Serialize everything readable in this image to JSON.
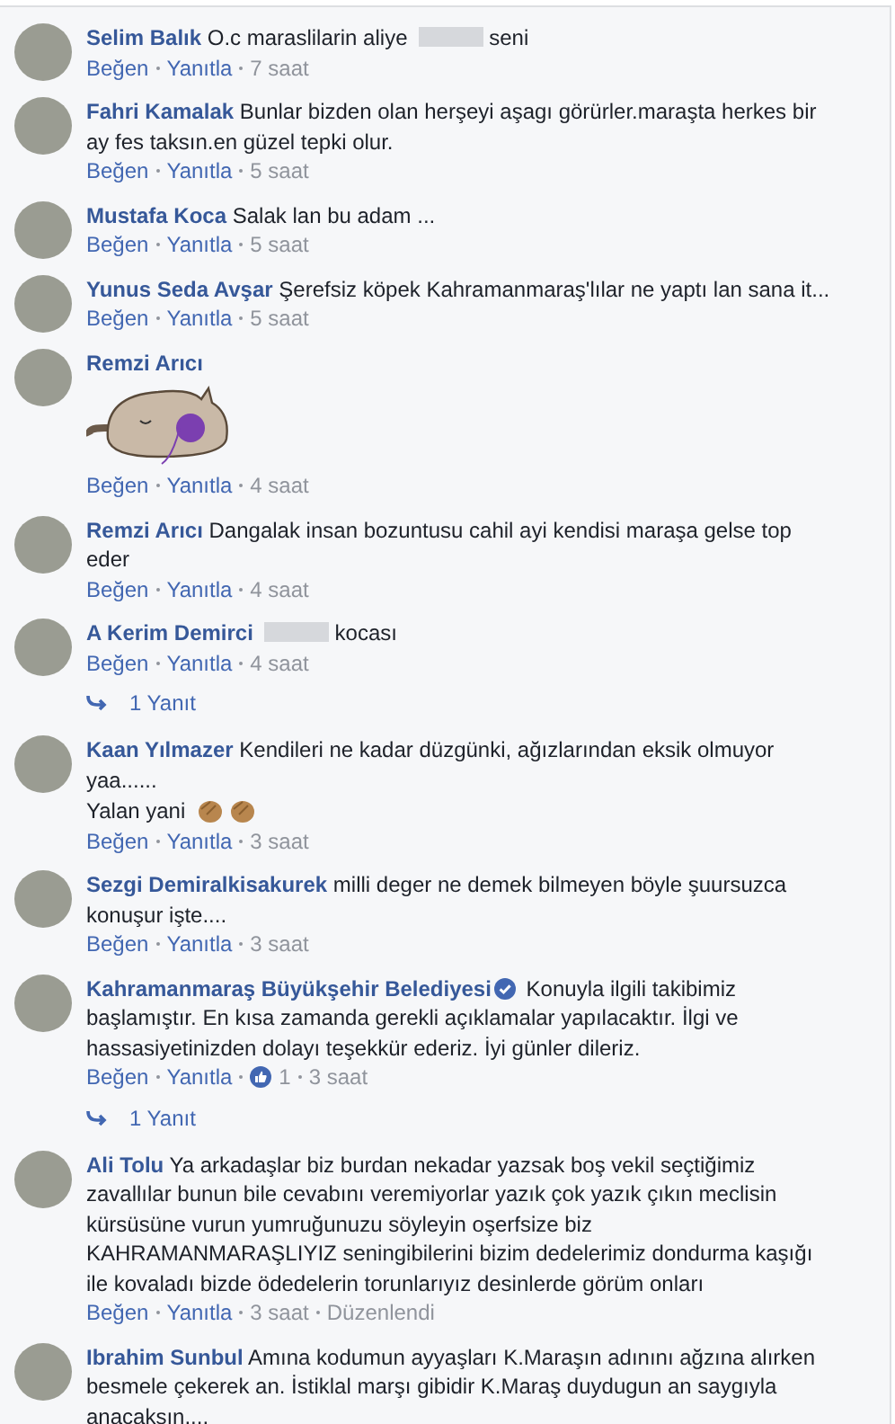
{
  "comments": [
    {
      "author": "Selim Balık",
      "parts": [
        {
          "kind": "text",
          "text": "O.c maraslilarin aliye"
        },
        {
          "kind": "blur"
        },
        {
          "kind": "text",
          "text": "seni"
        }
      ],
      "meta": [
        {
          "kind": "link",
          "text": "Beğen"
        },
        {
          "kind": "link",
          "text": "Yanıtla"
        },
        {
          "kind": "text",
          "text": "7 saat"
        }
      ]
    },
    {
      "author": "Fahri Kamalak",
      "parts": [
        {
          "kind": "text",
          "text": "Bunlar bizden olan herşeyi aşagı görürler.maraşta herkes bir ay fes taksın.en güzel tepki olur."
        }
      ],
      "meta": [
        {
          "kind": "link",
          "text": "Beğen"
        },
        {
          "kind": "link",
          "text": "Yanıtla"
        },
        {
          "kind": "text",
          "text": "5 saat"
        }
      ]
    },
    {
      "author": "Mustafa Koca",
      "parts": [
        {
          "kind": "text",
          "text": "Salak lan bu adam ..."
        }
      ],
      "meta": [
        {
          "kind": "link",
          "text": "Beğen"
        },
        {
          "kind": "link",
          "text": "Yanıtla"
        },
        {
          "kind": "text",
          "text": "5 saat"
        }
      ]
    },
    {
      "author": "Yunus Seda Avşar",
      "parts": [
        {
          "kind": "text",
          "text": "Şerefsiz köpek Kahramanmaraş'lılar ne yaptı lan sana it..."
        }
      ],
      "meta": [
        {
          "kind": "link",
          "text": "Beğen"
        },
        {
          "kind": "link",
          "text": "Yanıtla"
        },
        {
          "kind": "text",
          "text": "5 saat"
        }
      ]
    },
    {
      "author": "Remzi Arıcı",
      "parts": [
        {
          "kind": "sticker"
        }
      ],
      "meta": [
        {
          "kind": "link",
          "text": "Beğen"
        },
        {
          "kind": "link",
          "text": "Yanıtla"
        },
        {
          "kind": "text",
          "text": "4 saat"
        }
      ]
    },
    {
      "author": "Remzi Arıcı",
      "parts": [
        {
          "kind": "text",
          "text": "Dangalak insan bozuntusu cahil ayi kendisi maraşa gelse top eder"
        }
      ],
      "meta": [
        {
          "kind": "link",
          "text": "Beğen"
        },
        {
          "kind": "link",
          "text": "Yanıtla"
        },
        {
          "kind": "text",
          "text": "4 saat"
        }
      ]
    },
    {
      "author": "A Kerim Demirci",
      "parts": [
        {
          "kind": "blur"
        },
        {
          "kind": "text",
          "text": "kocası"
        }
      ],
      "meta": [
        {
          "kind": "link",
          "text": "Beğen"
        },
        {
          "kind": "link",
          "text": "Yanıtla"
        },
        {
          "kind": "text",
          "text": "4 saat"
        }
      ],
      "replies": "1 Yanıt"
    },
    {
      "author": "Kaan Yılmazer",
      "parts": [
        {
          "kind": "text",
          "text": "Kendileri ne kadar düzgünki, ağızlarından eksik olmuyor yaa......"
        },
        {
          "kind": "break"
        },
        {
          "kind": "text",
          "text": "Yalan yani"
        },
        {
          "kind": "emoji"
        },
        {
          "kind": "emoji"
        }
      ],
      "meta": [
        {
          "kind": "link",
          "text": "Beğen"
        },
        {
          "kind": "link",
          "text": "Yanıtla"
        },
        {
          "kind": "text",
          "text": "3 saat"
        }
      ]
    },
    {
      "author": "Sezgi Demiralkisakurek",
      "parts": [
        {
          "kind": "text",
          "text": "milli deger ne demek bilmeyen böyle şuursuzca konuşur işte...."
        }
      ],
      "meta": [
        {
          "kind": "link",
          "text": "Beğen"
        },
        {
          "kind": "link",
          "text": "Yanıtla"
        },
        {
          "kind": "text",
          "text": "3 saat"
        }
      ]
    },
    {
      "author": "Kahramanmaraş Büyükşehir Belediyesi",
      "verified": true,
      "parts": [
        {
          "kind": "text",
          "text": "Konuyla ilgili takibimiz başlamıştır. En kısa zamanda gerekli açıklamalar yapılacaktır. İlgi ve hassasiyetinizden dolayı teşekkür ederiz. İyi günler dileriz."
        }
      ],
      "meta": [
        {
          "kind": "link",
          "text": "Beğen"
        },
        {
          "kind": "link",
          "text": "Yanıtla"
        },
        {
          "kind": "likes",
          "text": "1"
        },
        {
          "kind": "text",
          "text": "3 saat"
        }
      ],
      "replies": "1 Yanıt"
    },
    {
      "author": "Ali Tolu",
      "parts": [
        {
          "kind": "text",
          "text": "Ya arkadaşlar biz burdan nekadar yazsak boş vekil seçtiğimiz zavallılar bunun bile cevabını veremiyorlar yazık çok yazık çıkın meclisin kürsüsüne vurun yumruğunuzu söyleyin oşerfsize biz KAHRAMANMARAŞLIYIZ seningibilerini bizim dedelerimiz dondurma kaşığı ile kovaladı bizde ödedelerin torunlarıyız desinlerde görüm onları"
        }
      ],
      "meta": [
        {
          "kind": "link",
          "text": "Beğen"
        },
        {
          "kind": "link",
          "text": "Yanıtla"
        },
        {
          "kind": "text",
          "text": "3 saat"
        },
        {
          "kind": "text",
          "text": "Düzenlendi"
        }
      ]
    },
    {
      "author": "Ibrahim Sunbul",
      "parts": [
        {
          "kind": "text",
          "text": "Amına kodumun ayyaşları K.Maraşın adınını ağzına alırken besmele çekerek an. İstiklal marşı gibidir K.Maraş duydugun an saygıyla anacaksın...."
        }
      ]
    }
  ]
}
